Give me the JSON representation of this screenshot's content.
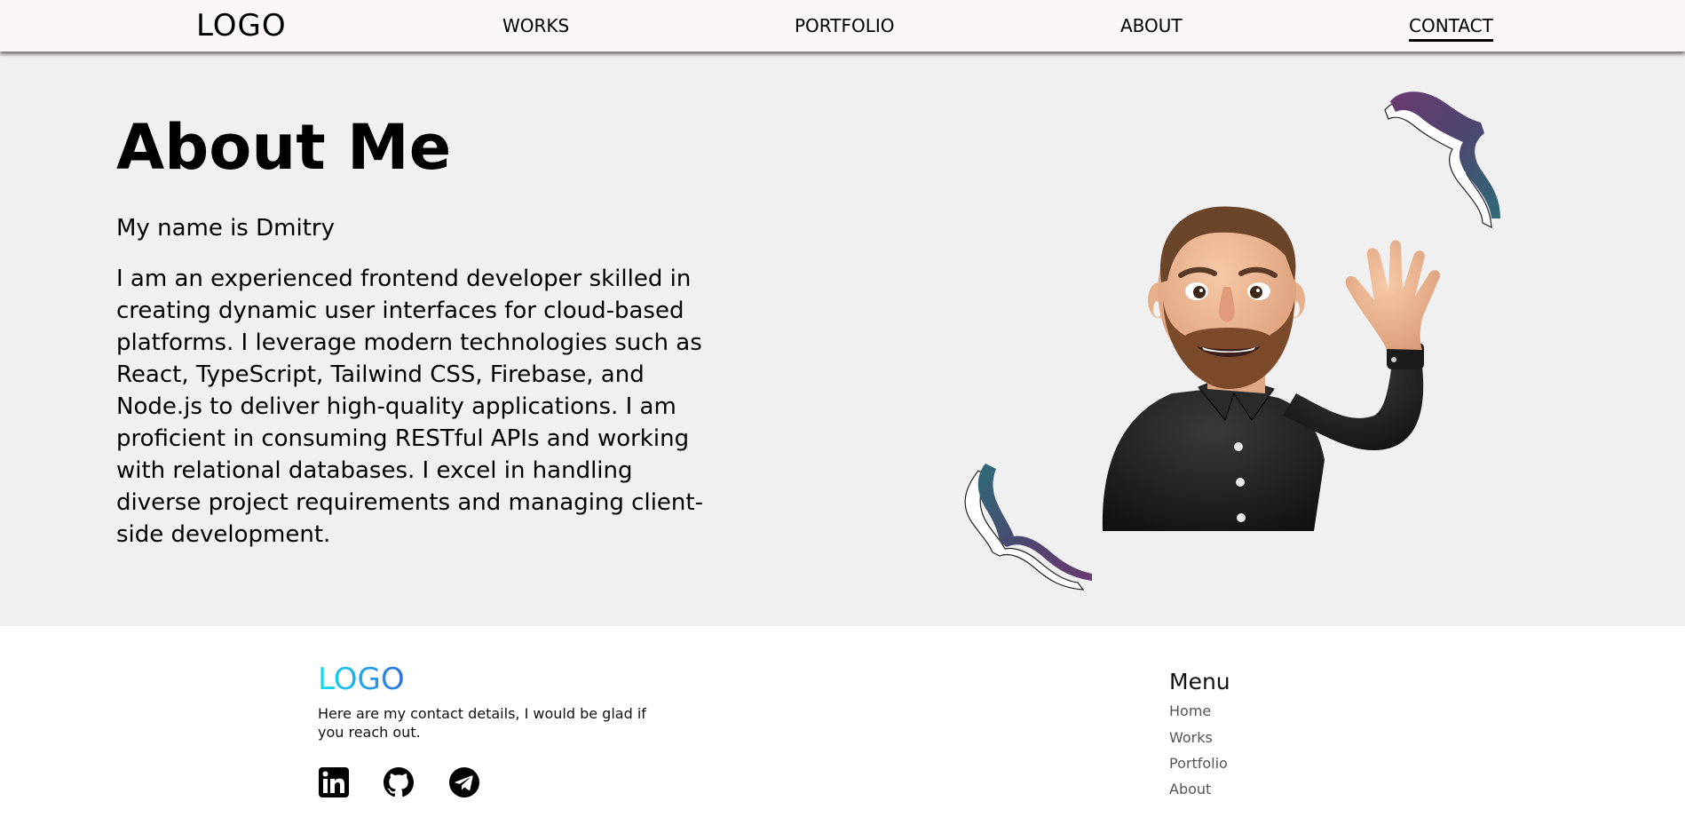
{
  "header": {
    "logo": "LOGO",
    "nav": [
      {
        "label": "WORKS"
      },
      {
        "label": "PORTFOLIO"
      },
      {
        "label": "ABOUT"
      },
      {
        "label": "CONTACT",
        "active": true
      }
    ]
  },
  "about": {
    "title": "About Me",
    "name_line": "My name is Dmitry",
    "bio": "I am an experienced frontend developer skilled in creating dynamic user interfaces for cloud-based platforms. I leverage modern technologies such as React, TypeScript, Tailwind CSS, Firebase, and Node.js to deliver high-quality applications. I am proficient in consuming RESTful APIs and working with relational databases. I excel in handling diverse project requirements and managing client-side development."
  },
  "illustration": {
    "avatar": "waving-memoji-avatar",
    "ribbons": [
      "ribbon-top",
      "ribbon-bottom"
    ]
  },
  "footer": {
    "logo": "LOGO",
    "text": "Here are my contact details, I would be glad if you reach out.",
    "social_icons": [
      "linkedin-icon",
      "github-icon",
      "telegram-icon"
    ],
    "menu": {
      "title": "Menu",
      "items": [
        "Home",
        "Works",
        "Portfolio",
        "About"
      ]
    }
  },
  "colors": {
    "header_bg": "#faf7f6",
    "main_bg": "#f0f0f0",
    "footer_bg": "#ffffff",
    "logo_gradient_start": "#14e0ee",
    "logo_gradient_end": "#2f6fe6",
    "ribbon_purple": "#5c3a6e",
    "ribbon_teal": "#2f6b78"
  }
}
